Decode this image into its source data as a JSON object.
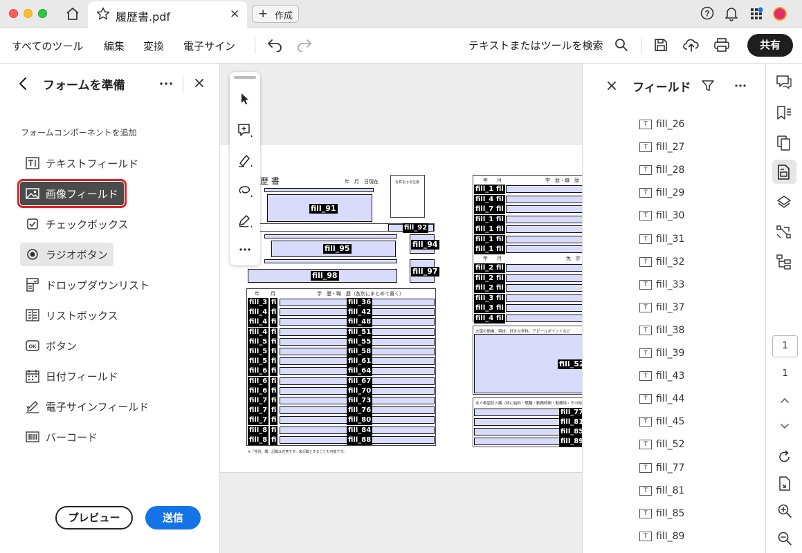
{
  "titlebar": {
    "doc_tab_name": "履歴書.pdf",
    "create_label": "作成"
  },
  "toolbar": {
    "menu": [
      "すべてのツール",
      "編集",
      "変換",
      "電子サイン"
    ],
    "search_label": "テキストまたはツールを検索",
    "share_label": "共有"
  },
  "left_panel": {
    "title": "フォームを準備",
    "section_label": "フォームコンポーネントを追加",
    "components": [
      {
        "label": "テキストフィールド",
        "icon": "text-field-icon"
      },
      {
        "label": "画像フィールド",
        "icon": "image-field-icon"
      },
      {
        "label": "チェックボックス",
        "icon": "checkbox-icon"
      },
      {
        "label": "ラジオボタン",
        "icon": "radio-button-icon"
      },
      {
        "label": "ドロップダウンリスト",
        "icon": "dropdown-list-icon"
      },
      {
        "label": "リストボックス",
        "icon": "list-box-icon"
      },
      {
        "label": "ボタン",
        "icon": "button-icon"
      },
      {
        "label": "日付フィールド",
        "icon": "date-field-icon"
      },
      {
        "label": "電子サインフィールド",
        "icon": "signature-field-icon"
      },
      {
        "label": "バーコード",
        "icon": "barcode-icon"
      }
    ],
    "selected_component": "画像フィールド",
    "preview_label": "プレビュー",
    "send_label": "送信"
  },
  "document": {
    "title_text": "歴 書",
    "date_text": "年　月　日現在",
    "photo_note": "写真をはる位置",
    "fields_named": {
      "f91": "fill_91",
      "f92": "fill_92",
      "f95": "fill_95",
      "f94": "fill_94",
      "f98": "fill_98",
      "f97": "fill_97",
      "f52": "fill_52"
    },
    "history_header": "学　歴・職　歴（各別にまとめて書く）",
    "year_hdr": "年",
    "month_hdr": "月",
    "history_rows": [
      {
        "l": "fill_3",
        "m": "fi",
        "r": "fill_36"
      },
      {
        "l": "fill_4",
        "m": "fi",
        "r": "fill_42"
      },
      {
        "l": "fill_4",
        "m": "fi",
        "r": "fill_48"
      },
      {
        "l": "fill_4",
        "m": "fi",
        "r": "fill_51"
      },
      {
        "l": "fill_5",
        "m": "fi",
        "r": "fill_55"
      },
      {
        "l": "fill_5",
        "m": "fi",
        "r": "fill_58"
      },
      {
        "l": "fill_5",
        "m": "fi",
        "r": "fill_61"
      },
      {
        "l": "fill_6",
        "m": "fi",
        "r": "fill_64"
      },
      {
        "l": "fill_6",
        "m": "fi",
        "r": "fill_67"
      },
      {
        "l": "fill_6",
        "m": "fi",
        "r": "fill_70"
      },
      {
        "l": "fill_7",
        "m": "fi",
        "r": "fill_73"
      },
      {
        "l": "fill_7",
        "m": "fi",
        "r": "fill_76"
      },
      {
        "l": "fill_7",
        "m": "fi",
        "r": "fill_80"
      },
      {
        "l": "fill_8",
        "m": "fi",
        "r": "fill_84"
      },
      {
        "l": "fill_8",
        "m": "fi",
        "r": "fill_88"
      }
    ],
    "right_rows_top": [
      "fill_1",
      "fill_4",
      "fill_7",
      "fill_1",
      "fill_1",
      "fill_1",
      "fill_1"
    ],
    "right_rows_mid": [
      "fill_2",
      "fill_2",
      "fill_2",
      "fill_3",
      "fill_3",
      "fill_4"
    ],
    "right_col_hdr": "学　歴・職　歴（各",
    "license_hdr": "免　許",
    "motivation_label": "志望の動機、特技、好きな学科、アピールポイントなど",
    "request_label": "本人希望記入欄（特に給料・職種・勤務時間・勤務地・その他に",
    "request_rows": [
      "fill_77",
      "fill_81",
      "fill_85",
      "fill_89"
    ],
    "footnote": "※「性別」欄：記載は任意です。未記載とすることも可能です。"
  },
  "fields_panel": {
    "title": "フィールド",
    "items": [
      "fill_26",
      "fill_27",
      "fill_28",
      "fill_29",
      "fill_30",
      "fill_31",
      "fill_32",
      "fill_33",
      "fill_37",
      "fill_38",
      "fill_39",
      "fill_43",
      "fill_44",
      "fill_45",
      "fill_52",
      "fill_77",
      "fill_81",
      "fill_85",
      "fill_89"
    ]
  },
  "rail": {
    "current_page": "1",
    "total_pages": "1"
  },
  "colors": {
    "accent": "#1473e6",
    "selected_bg": "#4b4b4b",
    "highlight_border": "#e02020",
    "field_fill": "#d9dbfb"
  }
}
